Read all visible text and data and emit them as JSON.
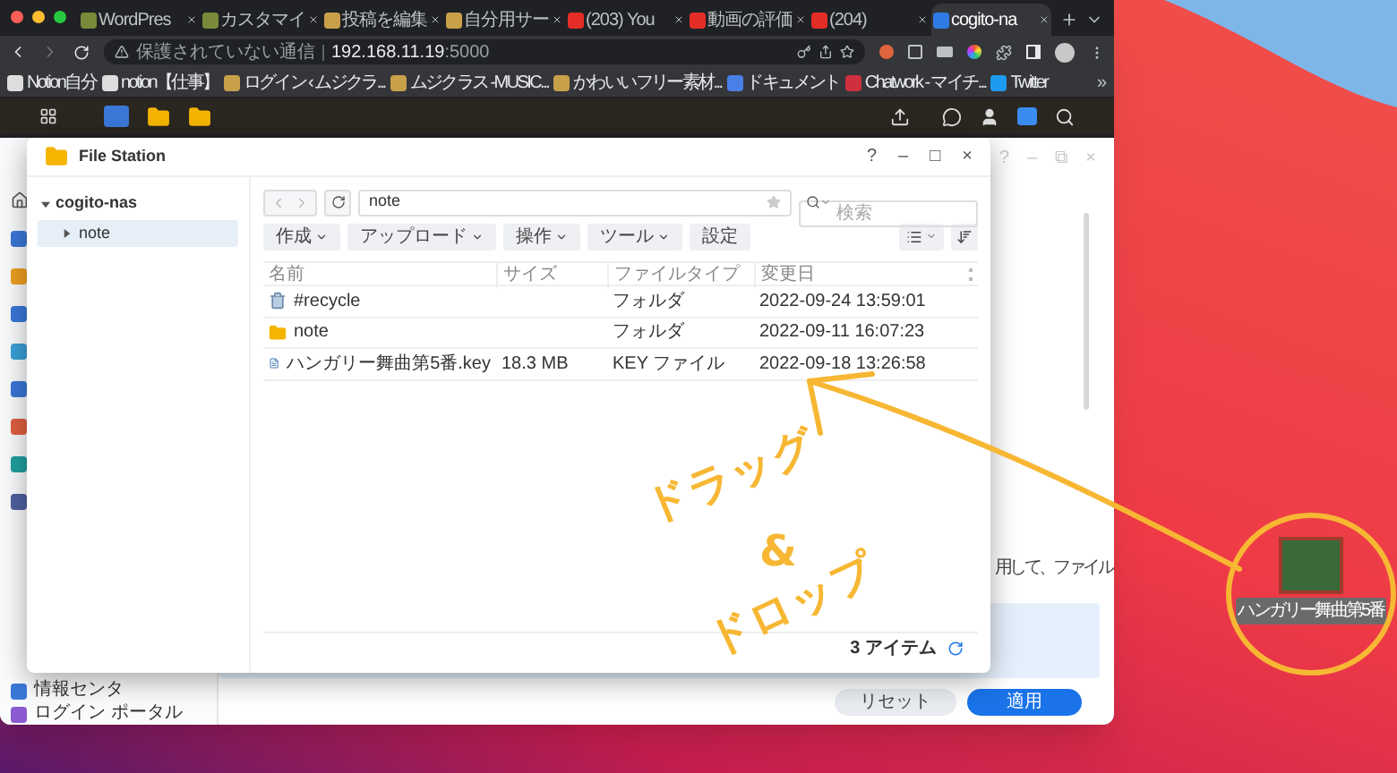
{
  "browser": {
    "tabs": [
      {
        "label": "WordPres",
        "kind": "site",
        "selected": false
      },
      {
        "label": "カスタマイ",
        "kind": "site",
        "selected": false
      },
      {
        "label": "投稿を編集",
        "kind": "music",
        "selected": false
      },
      {
        "label": "自分用サー",
        "kind": "music",
        "selected": false
      },
      {
        "label": "(203) You",
        "kind": "video",
        "selected": false
      },
      {
        "label": "動画の評価",
        "kind": "video",
        "selected": false
      },
      {
        "label": "(204)",
        "kind": "video",
        "selected": false
      },
      {
        "label": "cogito-na",
        "kind": "nas",
        "selected": true
      }
    ],
    "address": {
      "security": "保護されていない通信",
      "host": "192.168.11.19",
      "port": ":5000"
    },
    "bookmarks": [
      {
        "label": "Notion自分",
        "kind": "page"
      },
      {
        "label": "notion【仕事】",
        "kind": "page"
      },
      {
        "label": "ログイン ‹ ムジクラ...",
        "kind": "music"
      },
      {
        "label": "ムジクラス -MUSIC...",
        "kind": "music"
      },
      {
        "label": "かわいいフリー素材...",
        "kind": "image"
      },
      {
        "label": "ドキュメント",
        "kind": "doc"
      },
      {
        "label": "Chatwork - マイチ...",
        "kind": "chat"
      },
      {
        "label": "Twitter",
        "kind": "bird"
      }
    ],
    "bookmarks_more": "»"
  },
  "control_panel": {
    "window_controls": [
      "?",
      "–",
      "⧉",
      "×"
    ],
    "nav_items": [
      "情報センタ",
      "ログイン ポータル"
    ],
    "hint": "用して、ファイル",
    "buttons": [
      {
        "label": "リセット",
        "primary": false
      },
      {
        "label": "適用",
        "primary": true
      }
    ]
  },
  "file_station": {
    "title": "File Station",
    "window_controls": [
      "?",
      "–",
      "□",
      "×"
    ],
    "tree": {
      "label": "cogito-nas",
      "expanded": true,
      "children": [
        {
          "label": "note",
          "expanded": false,
          "selected": true
        }
      ]
    },
    "path": "note",
    "search": {
      "placeholder": "検索"
    },
    "toolbar": [
      {
        "label": "作成",
        "dropdown": true
      },
      {
        "label": "アップロード",
        "dropdown": true
      },
      {
        "label": "操作",
        "dropdown": true
      },
      {
        "label": "ツール",
        "dropdown": true
      },
      {
        "label": "設定",
        "dropdown": false
      }
    ],
    "columns": [
      "名前",
      "サイズ",
      "ファイルタイプ",
      "変更日"
    ],
    "rows": [
      {
        "kind": "recycle",
        "name": "#recycle",
        "size": "",
        "type": "フォルダ",
        "modified": "2022-09-24 13:59:01"
      },
      {
        "kind": "folder",
        "name": "note",
        "size": "",
        "type": "フォルダ",
        "modified": "2022-09-11 16:07:23"
      },
      {
        "kind": "file",
        "name": "ハンガリー舞曲第5番.key",
        "size": "18.3 MB",
        "type": "KEY ファイル",
        "modified": "2022-09-18 13:26:58"
      }
    ],
    "item_count": "3 アイテム"
  },
  "annotation": {
    "lines": [
      "ドラッグ",
      "&",
      "ドロップ"
    ]
  },
  "desktop_icon": {
    "label": "ハンガリー舞曲第5番"
  }
}
